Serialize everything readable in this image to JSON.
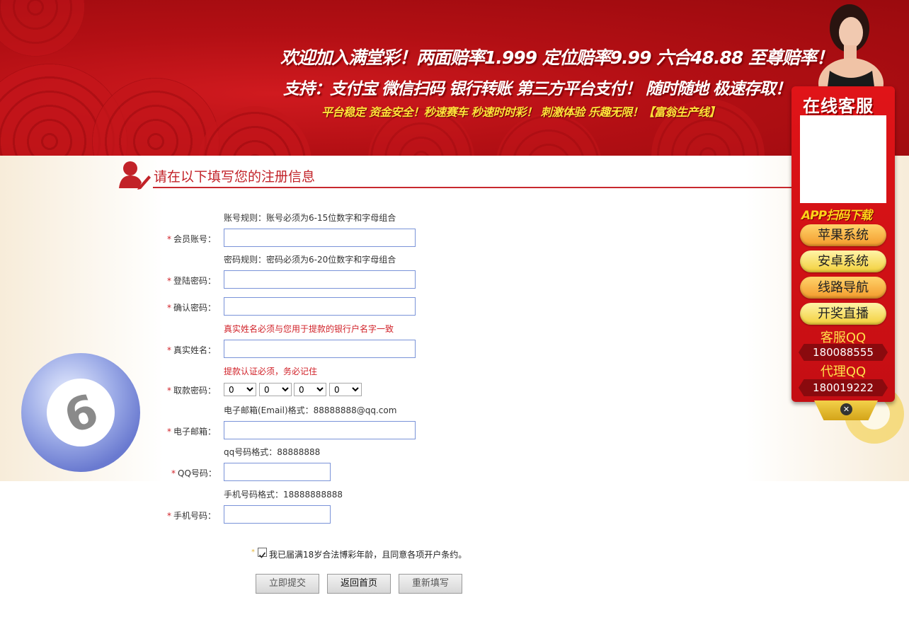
{
  "banner": {
    "line1": "欢迎加入满堂彩！两面赔率1.999  定位赔率9.99 六合48.88 至尊赔率！",
    "line2": "支持：支付宝 微信扫码 银行转账 第三方平台支付！ 随时随地 极速存取！",
    "line3": "平台稳定 资金安全！秒速赛车 秒速时时彩！ 刺激体验 乐趣无限！【富翁生产线】"
  },
  "section": {
    "title": "请在以下填写您的注册信息"
  },
  "form": {
    "account": {
      "hint": "账号规则：账号必须为6-15位数字和字母组合",
      "label": "会员账号：",
      "value": ""
    },
    "password": {
      "hint": "密码规则：密码必须为6-20位数字和字母组合",
      "label": "登陆密码：",
      "value": ""
    },
    "confirm": {
      "label": "确认密码：",
      "value": ""
    },
    "realname": {
      "hint": "真实姓名必须与您用于提款的银行户名字一致",
      "label": "真实姓名：",
      "value": ""
    },
    "withdraw": {
      "hint": "提款认证必须，务必记住",
      "label": "取款密码：",
      "digits": [
        "0",
        "0",
        "0",
        "0"
      ]
    },
    "email": {
      "hint": "电子邮箱(Email)格式：88888888@qq.com",
      "label": "电子邮箱：",
      "value": ""
    },
    "qq": {
      "hint": "qq号码格式：88888888",
      "label": "QQ号码：",
      "value": ""
    },
    "phone": {
      "hint": "手机号码格式：18888888888",
      "label": "手机号码：",
      "value": ""
    },
    "required_mark": "*",
    "agree_text": "我已届满18岁合法博彩年龄，且同意各项开户条约。",
    "agree_checked": true,
    "buttons": {
      "submit": "立即提交",
      "home": "返回首页",
      "reset": "重新填写"
    }
  },
  "service_panel": {
    "title": "在线客服",
    "app_download": "APP扫码下载",
    "buttons": [
      "苹果系统",
      "安卓系统",
      "线路导航",
      "开奖直播"
    ],
    "cs_qq_label": "客服QQ",
    "cs_qq": "180088555",
    "agent_qq_label": "代理QQ",
    "agent_qq": "180019222",
    "close_icon": "✕"
  },
  "ball_number": "6",
  "colors": {
    "brand_red": "#c22228",
    "banner_red": "#b30f14",
    "hint_red": "#d1232a",
    "input_border": "#7a93d8",
    "accent_yellow": "#ffe23a"
  }
}
